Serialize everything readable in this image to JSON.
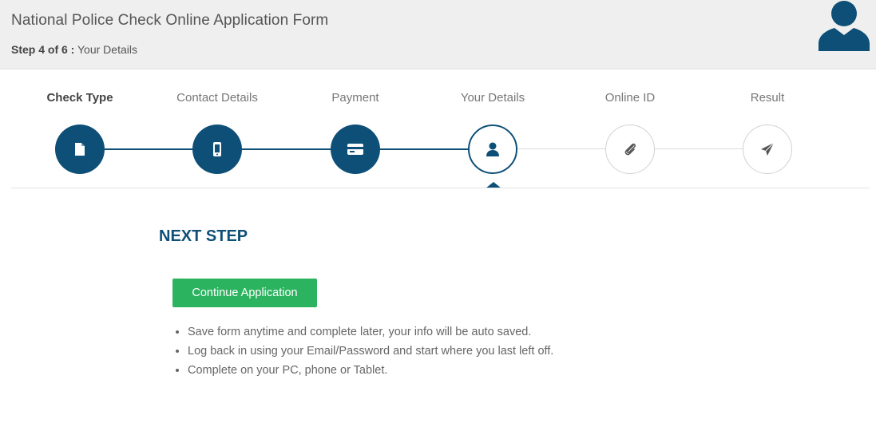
{
  "header": {
    "title": "National Police Check Online Application Form",
    "step_prefix": "Step 4 of 6 :",
    "step_name": "Your Details"
  },
  "steps": [
    {
      "label": "Check Type",
      "state": "done",
      "icon": "document-icon"
    },
    {
      "label": "Contact Details",
      "state": "done",
      "icon": "phone-icon"
    },
    {
      "label": "Payment",
      "state": "done",
      "icon": "credit-card-icon"
    },
    {
      "label": "Your Details",
      "state": "current",
      "icon": "person-icon"
    },
    {
      "label": "Online ID",
      "state": "todo",
      "icon": "paperclip-icon"
    },
    {
      "label": "Result",
      "state": "todo",
      "icon": "paper-plane-icon"
    }
  ],
  "main": {
    "heading": "NEXT STEP",
    "continue_label": "Continue Application",
    "bullets": [
      "Save form anytime and complete later, your info will be auto saved.",
      "Log back in using your Email/Password and start where you last left off.",
      "Complete on your PC, phone or Tablet."
    ]
  },
  "colors": {
    "primary": "#0e4f78",
    "button_green": "#2bb35f",
    "header_bg": "#efefef"
  }
}
